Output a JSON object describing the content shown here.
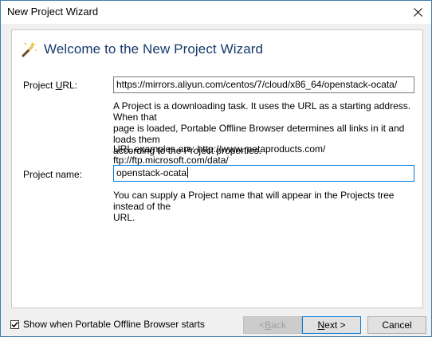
{
  "window": {
    "title": "New Project Wizard"
  },
  "heading": "Welcome to the New Project Wizard",
  "url_field": {
    "label_pre": "Project ",
    "label_u": "U",
    "label_post": "RL:",
    "value": "https://mirrors.aliyun.com/centos/7/cloud/x86_64/openstack-ocata/"
  },
  "url_help": {
    "line1": "A Project is a downloading task. It uses the URL as a starting address. When that",
    "line2": "page is loaded, Portable Offline Browser determines all links in it and loads them",
    "line3": "according to the Project properties.",
    "examples": "URL examples are: http://www.metaproducts.com/ ftp://ftp.microsoft.com/data/"
  },
  "name_field": {
    "label": "Project name:",
    "value": "openstack-ocata"
  },
  "name_help": {
    "line1": "You can supply a Project name that will appear in the Projects tree instead of the",
    "line2": "URL."
  },
  "footer": {
    "checkbox_label": "Show when Portable Offline Browser starts",
    "checkbox_checked": true,
    "back_pre": "< ",
    "back_u": "B",
    "back_post": "ack",
    "next_u": "N",
    "next_post": "ext >",
    "cancel_label": "Cancel"
  },
  "colors": {
    "heading": "#15386b",
    "focus_border": "#0078d7"
  },
  "icons": {
    "close": "close-icon",
    "wizard": "magic-wand-icon",
    "check": "checkmark-icon"
  }
}
